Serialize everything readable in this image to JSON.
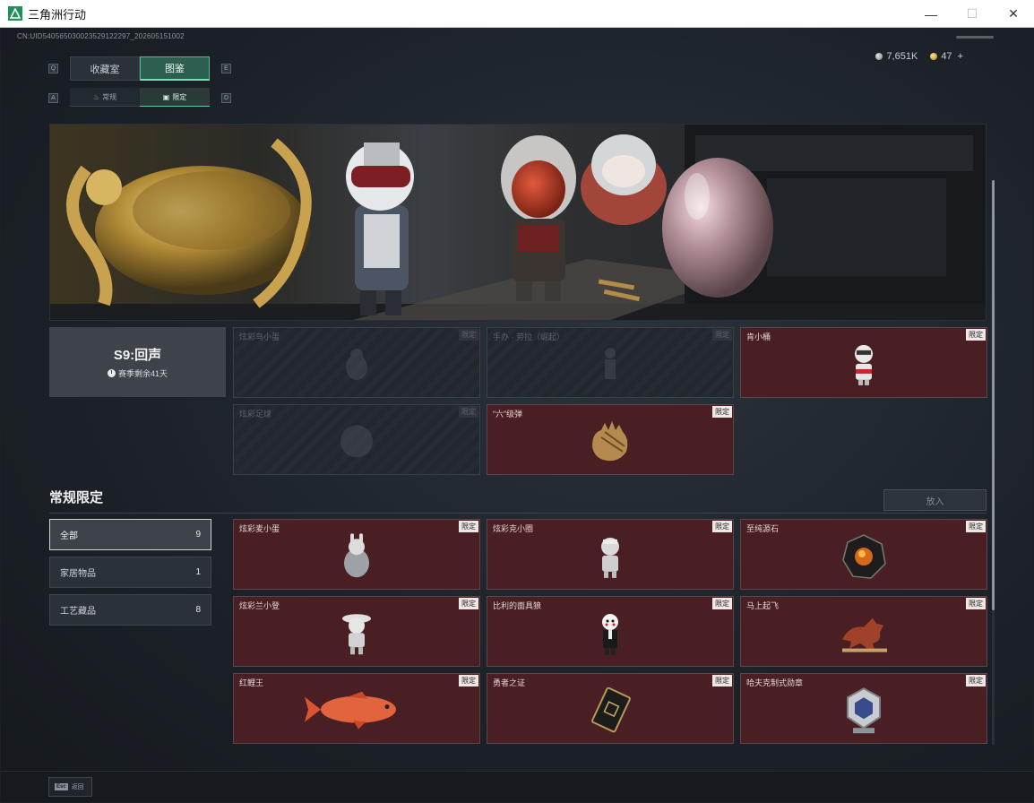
{
  "window": {
    "title": "三角洲行动",
    "minimize": "—",
    "maximize": "☐",
    "close": "✕"
  },
  "uid": "CN:UID540565030023529122297_202605151002",
  "currency": {
    "silver": "7,651K",
    "gold": "47",
    "plus": "+"
  },
  "key_hints": {
    "q": "Q",
    "e": "E",
    "a": "A",
    "d": "D"
  },
  "tabs": [
    {
      "label": "收藏室",
      "active": false
    },
    {
      "label": "图鉴",
      "active": true
    }
  ],
  "sub_tabs": [
    {
      "label": "常规",
      "icon": "flame-icon",
      "active": false
    },
    {
      "label": "限定",
      "icon": "image-icon",
      "active": true
    }
  ],
  "season": {
    "name": "S9:回声",
    "remaining": "赛季剩余41天"
  },
  "season_cards": [
    {
      "name": "炫彩鸟小蛋",
      "tag": "限定",
      "locked": true
    },
    {
      "name": "手办 · 劳拉（崛起）",
      "tag": "限定",
      "locked": true
    },
    {
      "name": "肯小桶",
      "tag": "限定",
      "locked": false
    },
    {
      "name": "炫彩足球",
      "tag": "限定",
      "locked": true
    },
    {
      "name": "“六”级弹",
      "tag": "限定",
      "locked": false
    }
  ],
  "section": {
    "title": "常规限定",
    "put_button": "放入"
  },
  "filters": [
    {
      "label": "全部",
      "count": "9",
      "active": true
    },
    {
      "label": "家居物品",
      "count": "1",
      "active": false
    },
    {
      "label": "工艺藏品",
      "count": "8",
      "active": false
    }
  ],
  "items": [
    {
      "name": "炫彩麦小蛋",
      "tag": "限定"
    },
    {
      "name": "炫彩克小圈",
      "tag": "限定"
    },
    {
      "name": "至纯源石",
      "tag": "限定"
    },
    {
      "name": "炫彩兰小登",
      "tag": "限定"
    },
    {
      "name": "比利的面具狼",
      "tag": "限定"
    },
    {
      "name": "马上起飞",
      "tag": "限定"
    },
    {
      "name": "红鲤王",
      "tag": "限定"
    },
    {
      "name": "勇者之证",
      "tag": "限定"
    },
    {
      "name": "哈夫克制式勋章",
      "tag": "限定"
    }
  ],
  "footer": {
    "esc_key": "Esc",
    "back_label": "返回"
  },
  "colors": {
    "accent": "#5ab88f",
    "card_bg": "#4a1f24",
    "locked_bg": "#22272d"
  }
}
